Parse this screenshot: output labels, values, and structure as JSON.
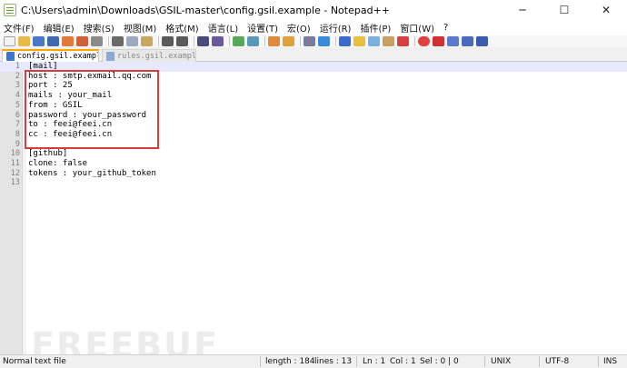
{
  "window": {
    "title": "C:\\Users\\admin\\Downloads\\GSIL-master\\config.gsil.example - Notepad++",
    "minimize_glyph": "─",
    "maximize_glyph": "☐",
    "close_glyph": "✕"
  },
  "menu": [
    "文件(F)",
    "编辑(E)",
    "搜索(S)",
    "视图(M)",
    "格式(M)",
    "语言(L)",
    "设置(T)",
    "宏(O)",
    "运行(R)",
    "插件(P)",
    "窗口(W)",
    "?"
  ],
  "tabs": [
    {
      "label": "config.gsil.example",
      "active": true,
      "close": "✕"
    },
    {
      "label": "rules.gsil.example",
      "active": false
    }
  ],
  "editor": {
    "lines": [
      {
        "n": "1",
        "text": "[mail]"
      },
      {
        "n": "2",
        "text": "host : smtp.exmail.qq.com"
      },
      {
        "n": "3",
        "text": "port : 25"
      },
      {
        "n": "4",
        "text": "mails : your_mail"
      },
      {
        "n": "5",
        "text": "from : GSIL"
      },
      {
        "n": "6",
        "text": "password : your_password"
      },
      {
        "n": "7",
        "text": "to : feei@feei.cn"
      },
      {
        "n": "8",
        "text": "cc : feei@feei.cn"
      },
      {
        "n": "9",
        "text": ""
      },
      {
        "n": "10",
        "text": "[github]"
      },
      {
        "n": "11",
        "text": "clone: false"
      },
      {
        "n": "12",
        "text": "tokens : your_github_token"
      },
      {
        "n": "13",
        "text": ""
      }
    ],
    "current_line": 1,
    "highlight_color": "#d83c3c"
  },
  "watermark": "FREEBUF",
  "status": {
    "file_type": "Normal text file",
    "length": "length : 184",
    "lines": "lines : 13",
    "ln": "Ln : 1",
    "col": "Col : 1",
    "sel": "Sel : 0 | 0",
    "eol": "UNIX",
    "encoding": "UTF-8",
    "mode": "INS"
  },
  "toolbar_icons": [
    "new-icon",
    "open-icon",
    "save-icon",
    "save-all-icon",
    "close-icon",
    "close-all-icon",
    "print-icon",
    "cut-icon",
    "copy-icon",
    "paste-icon",
    "undo-icon",
    "redo-icon",
    "find-icon",
    "replace-icon",
    "zoom-in-icon",
    "zoom-out-icon",
    "sync-v-icon",
    "sync-h-icon",
    "wrap-icon",
    "all-chars-icon",
    "indent-guide-icon",
    "doc-map-icon",
    "function-list-icon",
    "folder-workspace-icon",
    "monitor-icon",
    "record-macro-icon",
    "stop-record-icon",
    "play-macro-icon",
    "play-multi-icon",
    "save-macro-icon"
  ]
}
